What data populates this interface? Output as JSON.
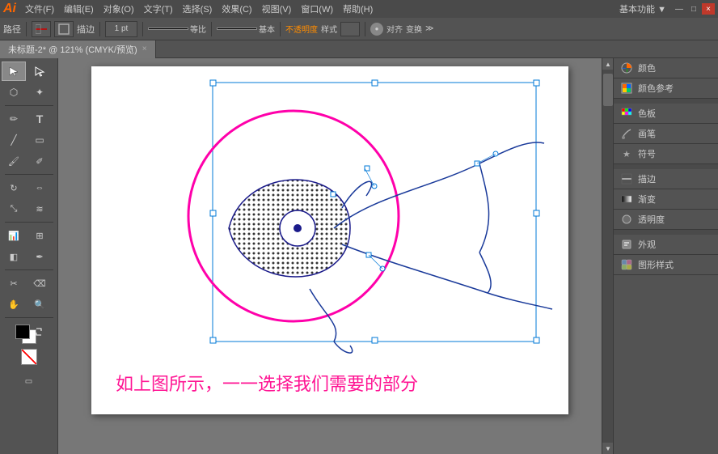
{
  "titlebar": {
    "logo": "Ai",
    "menus": [
      "文件(F)",
      "编辑(E)",
      "对象(O)",
      "文字(T)",
      "选择(S)",
      "效果(C)",
      "视图(V)",
      "窗口(W)",
      "帮助(H)"
    ],
    "workspace": "基本功能 ▼",
    "win_buttons": [
      "—",
      "□",
      "×"
    ]
  },
  "toolbar": {
    "label": "路径",
    "stroke_options": [
      "描边"
    ],
    "stroke_width": "1 pt",
    "line_label1": "等比",
    "line_label2": "基本",
    "opacity_label": "不透明度",
    "style_label": "样式",
    "align_label": "对齐",
    "transform_label": "变换"
  },
  "tab": {
    "title": "未标题-2* @ 121% (CMYK/预览)",
    "close": "×"
  },
  "canvas": {
    "bottom_text": "如上图所示，一一选择我们需要的部分"
  },
  "right_panel": {
    "items": [
      {
        "label": "颜色",
        "icon": "color-icon"
      },
      {
        "label": "颜色参考",
        "icon": "color-ref-icon"
      },
      {
        "label": "色板",
        "icon": "swatch-icon"
      },
      {
        "label": "画笔",
        "icon": "brush-icon"
      },
      {
        "label": "符号",
        "icon": "symbol-icon"
      },
      {
        "label": "描边",
        "icon": "stroke-icon"
      },
      {
        "label": "渐变",
        "icon": "gradient-icon"
      },
      {
        "label": "透明度",
        "icon": "transparency-icon"
      },
      {
        "label": "外观",
        "icon": "appearance-icon"
      },
      {
        "label": "图形样式",
        "icon": "graphic-style-icon"
      }
    ]
  },
  "tools": {
    "items": [
      "↖",
      "↗",
      "✏",
      "T",
      "⬟",
      "✂",
      "⬡",
      "⚙",
      "📐",
      "🖊",
      "🔍",
      "⬛",
      "◯",
      "🖋",
      "🔧",
      "🎨",
      "📊",
      "📏",
      "✋",
      "🔎"
    ]
  }
}
